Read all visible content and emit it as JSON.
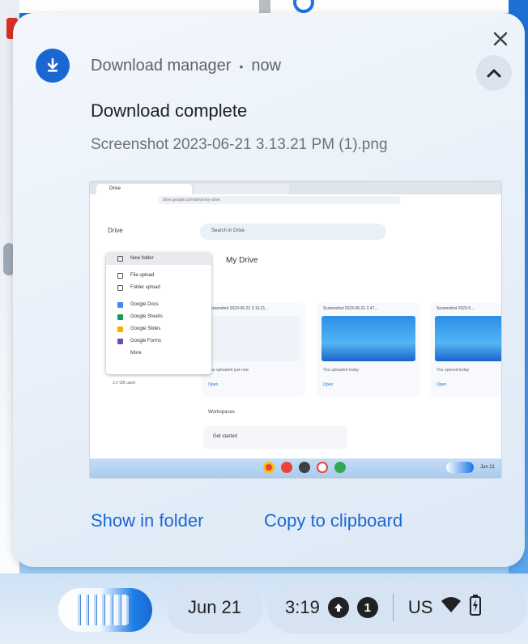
{
  "notification": {
    "source": "Download manager",
    "separator": "•",
    "time": "now",
    "title": "Download complete",
    "filename": "Screenshot 2023-06-21 3.13.21 PM (1).png",
    "actions": {
      "show_in_folder": "Show in folder",
      "copy_to_clipboard": "Copy to clipboard"
    },
    "icons": {
      "app": "download-icon",
      "close": "close-icon",
      "collapse": "chevron-up-icon"
    }
  },
  "preview": {
    "tab1": "Drive",
    "tab2": "",
    "url": "drive.google.com/drive/my-drive",
    "app": "Drive",
    "search_placeholder": "Search in Drive",
    "heading": "My Drive",
    "new_menu": [
      "New folder",
      "File upload",
      "Folder upload",
      "Google Docs",
      "Google Sheets",
      "Google Slides",
      "Google Forms",
      "More"
    ],
    "cards": [
      {
        "name": "Screenshot 2023-06-21 3.13.21...",
        "meta": "You uploaded just now",
        "open": "Open"
      },
      {
        "name": "Screenshot 2023-06-21 2.47...",
        "meta": "You uploaded today",
        "open": "Open"
      },
      {
        "name": "Screenshot 2023-0...",
        "meta": "You opened today",
        "open": "Open"
      }
    ],
    "section": "Workspaces",
    "folder": "Get started",
    "storage": "2.2 GB used",
    "date": "Jun 21"
  },
  "shelf": {
    "date": "Jun 21",
    "time": "3:19",
    "notification_count": "1",
    "ime": "US",
    "icons": [
      "cloud-upload-icon",
      "wifi-icon",
      "battery-icon"
    ]
  },
  "colors": {
    "accent": "#1a67d2",
    "card_bg": "#eaf1f9",
    "wallpaper": "#2b86e6"
  }
}
